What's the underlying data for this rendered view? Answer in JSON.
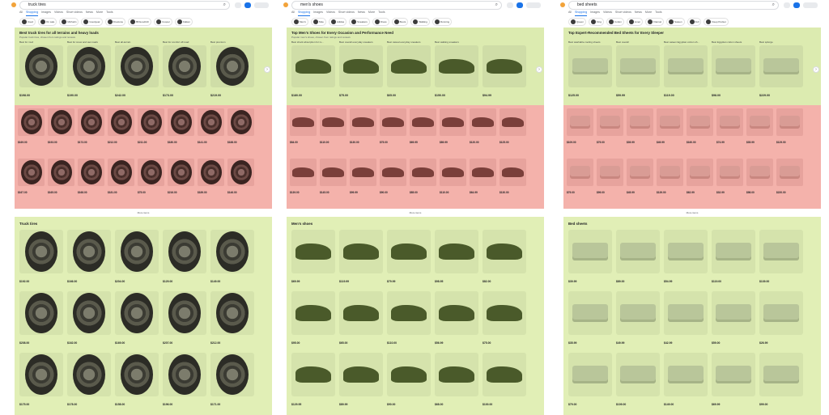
{
  "colors": {
    "green_band": "#dcebb0",
    "red_band": "#f4b2ab",
    "accent": "#1a73e8"
  },
  "panels": [
    {
      "query": "truck tires",
      "nav": [
        "All",
        "Shopping",
        "Images",
        "Videos",
        "Short videos",
        "News",
        "More",
        "Tools"
      ],
      "chips": [
        "Used",
        "On sale",
        "Michelin",
        "Goodyear",
        "Firestone",
        "BFGoodrich",
        "Cooper",
        "Falken"
      ],
      "section_title": "Best truck tires for all terrains and heavy loads",
      "section_sub": "Popular truck tires, chosen from ratings and reviews",
      "top_captions": [
        "Best for mud",
        "Best for snow and wet roads",
        "Best all-terrain",
        "Best for comfort off-road",
        "Best premium"
      ],
      "top_prices": [
        "$198.00",
        "$190.00",
        "$242.00",
        "$173.00",
        "$219.00"
      ],
      "tiles_row1_prices": [
        "$169.00",
        "$193.00",
        "$173.00",
        "$212.00",
        "$211.00",
        "$180.00",
        "$141.00",
        "$188.00"
      ],
      "tiles_row2_prices": [
        "$167.00",
        "$165.00",
        "$168.00",
        "$181.00",
        "$75.00",
        "$216.00",
        "$189.00",
        "$146.00"
      ],
      "more_label": "More items",
      "grid_title": "Truck tires",
      "grid_prices": [
        "$192.00",
        "$166.00",
        "$204.00",
        "$129.00",
        "$149.00",
        "$208.00",
        "$162.00",
        "$169.00",
        "$207.00",
        "$212.00",
        "$175.00",
        "$178.00",
        "$158.00",
        "$196.00",
        "$171.00"
      ]
    },
    {
      "query": "men's shoes",
      "nav": [
        "All",
        "Shopping",
        "Images",
        "Videos",
        "Short videos",
        "News",
        "More",
        "Tools"
      ],
      "chips": [
        "Men's",
        "Nike",
        "Adidas",
        "Sneakers",
        "Dress",
        "Boots",
        "Walking",
        "Running"
      ],
      "section_title": "Top Men's Shoes for Every Occasion and Performance Need",
      "section_sub": "Popular men's shoes, chosen from ratings and reviews",
      "top_captions": [
        "Best shock absorption for ru...",
        "Best overall everyday sneakers",
        "Best casual everyday sneakers",
        "Best walking sneakers",
        ""
      ],
      "top_prices": [
        "$180.00",
        "$75.00",
        "$65.00",
        "$150.00",
        "$94.99"
      ],
      "tiles_row1_prices": [
        "$84.00",
        "$110.00",
        "$130.00",
        "$75.00",
        "$69.95",
        "$89.99",
        "$120.00",
        "$125.00"
      ],
      "tiles_row2_prices": [
        "$139.00",
        "$145.00",
        "$99.99",
        "$90.00",
        "$85.00",
        "$110.00",
        "$64.99",
        "$130.00"
      ],
      "more_label": "More items",
      "grid_title": "Men's shoes",
      "grid_prices": [
        "$69.99",
        "$119.99",
        "$79.99",
        "$98.95",
        "$82.00",
        "$95.00",
        "$65.00",
        "$110.00",
        "$56.99",
        "$75.00",
        "$129.95",
        "$89.99",
        "$90.00",
        "$68.00",
        "$100.00"
      ]
    },
    {
      "query": "bed sheets",
      "nav": [
        "All",
        "Shopping",
        "Images",
        "Videos",
        "Short videos",
        "News",
        "More",
        "Tools"
      ],
      "chips": [
        "Queen",
        "King",
        "Cotton",
        "Linen",
        "Flannel",
        "Sateen",
        "Full",
        "Deep Pocket"
      ],
      "section_title": "Top Expert-Recommended Bed Sheets for Every Sleeper",
      "section_sub": "",
      "top_captions": [
        "Best washable cooling sheets",
        "Best overall",
        "Best sateen Egyptian cotton sh...",
        "Best Egyptian cotton sheets",
        "Best splurge"
      ],
      "top_prices": [
        "$125.00",
        "$59.99",
        "$119.00",
        "$98.00",
        "$229.00"
      ],
      "tiles_row1_prices": [
        "$109.00",
        "$79.00",
        "$39.99",
        "$49.99",
        "$160.00",
        "$74.99",
        "$35.99",
        "$129.00"
      ],
      "tiles_row2_prices": [
        "$79.00",
        "$99.00",
        "$45.99",
        "$139.00",
        "$62.99",
        "$32.99",
        "$98.00",
        "$220.00"
      ],
      "more_label": "More items",
      "grid_title": "Bed sheets",
      "grid_prices": [
        "$39.99",
        "$89.00",
        "$54.99",
        "$119.00",
        "$139.00",
        "$35.99",
        "$49.99",
        "$42.99",
        "$59.00",
        "$26.99",
        "$79.00",
        "$109.00",
        "$149.00",
        "$69.99",
        "$99.00"
      ]
    }
  ]
}
